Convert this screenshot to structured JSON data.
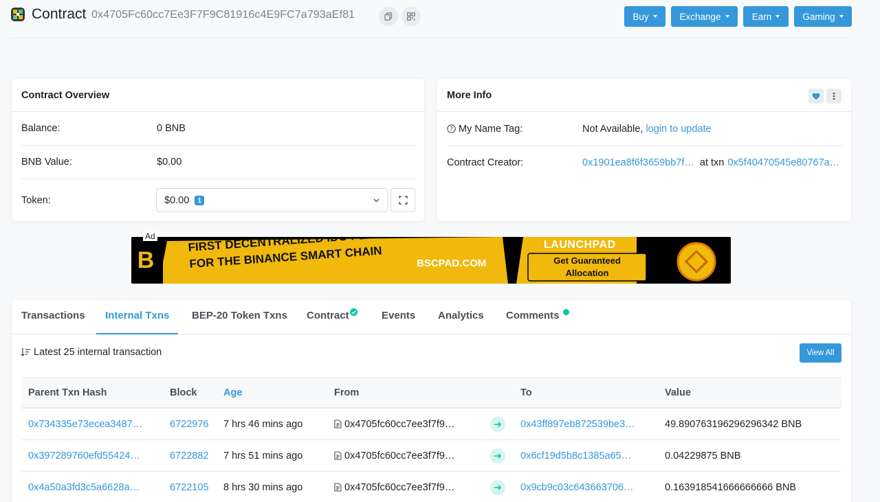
{
  "header": {
    "title": "Contract",
    "address": "0x4705Fc60cc7Ee3F7F9C81916c4E9FC7a793aEf81",
    "nav": [
      {
        "label": "Buy"
      },
      {
        "label": "Exchange"
      },
      {
        "label": "Earn"
      },
      {
        "label": "Gaming"
      }
    ]
  },
  "overview": {
    "title": "Contract Overview",
    "balance_label": "Balance:",
    "balance_value": "0 BNB",
    "bnb_value_label": "BNB Value:",
    "bnb_value": "$0.00",
    "token_label": "Token:",
    "token_value": "$0.00",
    "token_count": "1"
  },
  "more_info": {
    "title": "More Info",
    "name_tag_label": "My Name Tag:",
    "name_tag_value": "Not Available,",
    "name_tag_link": "login to update",
    "creator_label": "Contract Creator:",
    "creator_address": "0x1901ea8f6f3659bb7f…",
    "creator_at": "at txn",
    "creator_txn": "0x5f40470545e80767a…"
  },
  "ad": {
    "label": "Ad",
    "line1": "FIRST DECENTRALIZED IDO PLATFORM",
    "line2": "FOR THE BINANCE SMART CHAIN",
    "site": "BSCPAD.COM",
    "launchpad": "LAUNCHPAD",
    "cta1": "Get Guaranteed",
    "cta2": "Allocation"
  },
  "tabs": [
    {
      "label": "Transactions"
    },
    {
      "label": "Internal Txns"
    },
    {
      "label": "BEP-20 Token Txns"
    },
    {
      "label": "Contract"
    },
    {
      "label": "Events"
    },
    {
      "label": "Analytics"
    },
    {
      "label": "Comments"
    }
  ],
  "table": {
    "summary": "Latest 25 internal transaction",
    "view_all": "View All",
    "headers": [
      "Parent Txn Hash",
      "Block",
      "Age",
      "From",
      "To",
      "Value"
    ],
    "rows": [
      {
        "hash": "0x734335e73ecea3487…",
        "block": "6722976",
        "age": "7 hrs 46 mins ago",
        "from": "0x4705fc60cc7ee3f7f9…",
        "to": "0x43ff897eb872539be3…",
        "value": "49.890763196296296342 BNB"
      },
      {
        "hash": "0x397289760efd55424…",
        "block": "6722882",
        "age": "7 hrs 51 mins ago",
        "from": "0x4705fc60cc7ee3f7f9…",
        "to": "0x6cf19d5b8c1385a65…",
        "value": "0.04229875 BNB"
      },
      {
        "hash": "0x4a50a3fd3c5a6628a…",
        "block": "6722105",
        "age": "8 hrs 30 mins ago",
        "from": "0x4705fc60cc7ee3f7f9…",
        "to": "0x9cb9c03c643663706…",
        "value": "0.163918541666666666 BNB"
      }
    ]
  },
  "colors": {
    "accent": "#3498db",
    "success": "#00c9a7",
    "banner_yellow": "#f0b90b"
  }
}
